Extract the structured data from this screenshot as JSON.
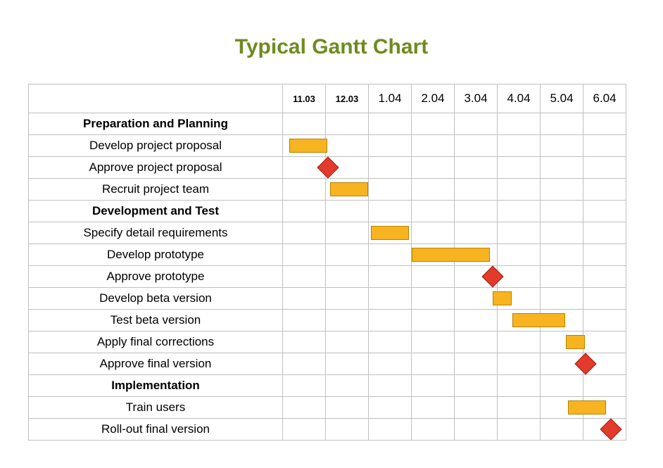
{
  "title": "Typical Gantt Chart",
  "columns": [
    {
      "label": "11.03",
      "small": true
    },
    {
      "label": "12.03",
      "small": true
    },
    {
      "label": "1.04",
      "small": false
    },
    {
      "label": "2.04",
      "small": false
    },
    {
      "label": "3.04",
      "small": false
    },
    {
      "label": "4.04",
      "small": false
    },
    {
      "label": "5.04",
      "small": false
    },
    {
      "label": "6.04",
      "small": false
    }
  ],
  "rows": [
    {
      "label": "Preparation and Planning",
      "group": true,
      "bars": [],
      "milestones": []
    },
    {
      "label": "Develop project proposal",
      "group": false,
      "bars": [
        {
          "start": 0.15,
          "span": 0.9
        }
      ],
      "milestones": []
    },
    {
      "label": "Approve project proposal",
      "group": false,
      "bars": [],
      "milestones": [
        {
          "at": 1.05
        }
      ]
    },
    {
      "label": "Recruit project team",
      "group": false,
      "bars": [
        {
          "start": 1.1,
          "span": 0.9
        }
      ],
      "milestones": []
    },
    {
      "label": "Development and Test",
      "group": true,
      "bars": [],
      "milestones": []
    },
    {
      "label": "Specify detail requirements",
      "group": false,
      "bars": [
        {
          "start": 2.05,
          "span": 0.9
        }
      ],
      "milestones": []
    },
    {
      "label": "Develop prototype",
      "group": false,
      "bars": [
        {
          "start": 3.0,
          "span": 1.85
        }
      ],
      "milestones": []
    },
    {
      "label": "Approve prototype",
      "group": false,
      "bars": [],
      "milestones": [
        {
          "at": 4.9
        }
      ]
    },
    {
      "label": "Develop beta version",
      "group": false,
      "bars": [
        {
          "start": 4.9,
          "span": 0.45
        }
      ],
      "milestones": []
    },
    {
      "label": "Test beta version",
      "group": false,
      "bars": [
        {
          "start": 5.35,
          "span": 1.25
        }
      ],
      "milestones": []
    },
    {
      "label": "Apply final corrections",
      "group": false,
      "bars": [
        {
          "start": 6.6,
          "span": 0.45
        }
      ],
      "milestones": []
    },
    {
      "label": "Approve final version",
      "group": false,
      "bars": [],
      "milestones": [
        {
          "at": 7.05
        }
      ]
    },
    {
      "label": "Implementation",
      "group": true,
      "bars": [],
      "milestones": []
    },
    {
      "label": "Train users",
      "group": false,
      "bars": [
        {
          "start": 6.65,
          "span": 0.9
        }
      ],
      "milestones": []
    },
    {
      "label": "Roll-out final version",
      "group": false,
      "bars": [],
      "milestones": [
        {
          "at": 7.65
        }
      ]
    }
  ],
  "colors": {
    "title": "#6e8b1f",
    "bar_fill": "#f7b420",
    "bar_border": "#b98200",
    "milestone_fill": "#e23a2b",
    "milestone_border": "#a11b10",
    "grid": "#c0c0c0"
  },
  "chart_data": {
    "type": "gantt",
    "title": "Typical Gantt Chart",
    "time_axis": [
      "11.03",
      "12.03",
      "1.04",
      "2.04",
      "3.04",
      "4.04",
      "5.04",
      "6.04"
    ],
    "groups": [
      {
        "name": "Preparation and Planning",
        "tasks": [
          {
            "name": "Develop project proposal",
            "type": "task",
            "start": "11.03",
            "end": "12.03"
          },
          {
            "name": "Approve project proposal",
            "type": "milestone",
            "at": "12.03"
          },
          {
            "name": "Recruit project team",
            "type": "task",
            "start": "12.03",
            "end": "1.04"
          }
        ]
      },
      {
        "name": "Development and Test",
        "tasks": [
          {
            "name": "Specify detail requirements",
            "type": "task",
            "start": "1.04",
            "end": "2.04"
          },
          {
            "name": "Develop prototype",
            "type": "task",
            "start": "2.04",
            "end": "3.04 (late)"
          },
          {
            "name": "Approve prototype",
            "type": "milestone",
            "at": "3.04 (late)"
          },
          {
            "name": "Develop beta version",
            "type": "task",
            "start": "3.04 (late)",
            "end": "4.04 (mid)"
          },
          {
            "name": "Test beta version",
            "type": "task",
            "start": "4.04 (mid)",
            "end": "5.04 (mid)"
          },
          {
            "name": "Apply final corrections",
            "type": "task",
            "start": "5.04 (mid)",
            "end": "6.04"
          },
          {
            "name": "Approve final version",
            "type": "milestone",
            "at": "6.04"
          }
        ]
      },
      {
        "name": "Implementation",
        "tasks": [
          {
            "name": "Train users",
            "type": "task",
            "start": "5.04 (late)",
            "end": "6.04 (mid)"
          },
          {
            "name": "Roll-out final version",
            "type": "milestone",
            "at": "6.04 (mid)"
          }
        ]
      }
    ]
  }
}
